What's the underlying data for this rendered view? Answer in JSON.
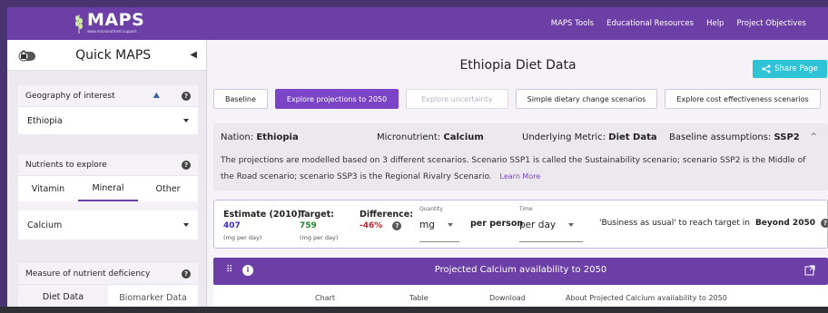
{
  "app": {
    "logo_text": "MAPS",
    "logo_url": "www.micronutrient.support"
  },
  "topnav": [
    "MAPS Tools",
    "Educational Resources",
    "Help",
    "Project Objectives"
  ],
  "sidebar": {
    "title": "Quick MAPS",
    "geography": {
      "label": "Geography of interest",
      "value": "Ethiopia"
    },
    "nutrients": {
      "label": "Nutrients to explore",
      "tabs": [
        "Vitamin",
        "Mineral",
        "Other"
      ],
      "active_tab": "Mineral",
      "value": "Calcium"
    },
    "deficiency": {
      "label": "Measure of nutrient deficiency",
      "tabs": [
        "Diet Data",
        "Biomarker Data"
      ],
      "active_tab": "Diet Data"
    }
  },
  "main": {
    "title": "Ethiopia Diet Data",
    "share_label": "Share Page",
    "tabs": [
      {
        "label": "Baseline",
        "state": "normal"
      },
      {
        "label": "Explore projections to 2050",
        "state": "active"
      },
      {
        "label": "Explore uncertainty",
        "state": "disabled"
      },
      {
        "label": "Simple dietary change scenarios",
        "state": "normal"
      },
      {
        "label": "Explore cost effectiveness scenarios",
        "state": "normal"
      }
    ],
    "info": {
      "nation_label": "Nation:",
      "nation": "Ethiopia",
      "micronutrient_label": "Micronutrient:",
      "micronutrient": "Calcium",
      "metric_label": "Underlying Metric:",
      "metric": "Diet Data",
      "assumptions_label": "Baseline assumptions:",
      "assumptions": "SSP2",
      "description": "The projections are modelled based on 3 different scenarios. Scenario SSP1 is called the Sustainability scenario; scenario SSP2 is the Middle of the Road scenario; scenario SSP3 is the Regional Rivalry Scenario.",
      "learn_more": "Learn More"
    },
    "estimate": {
      "estimate_label": "Estimate (2010):",
      "estimate_value": "407",
      "estimate_unit": "(mg per day)",
      "target_label": "Target:",
      "target_value": "759",
      "target_unit": "(mg per day)",
      "difference_label": "Difference:",
      "difference_value": "-46%",
      "quantity_label": "Quantity",
      "quantity_value": "mg",
      "per_person": "per person",
      "time_label": "Time",
      "time_value": "per day",
      "bau_text": "'Business as usual' to reach target in",
      "bau_value": "Beyond 2050"
    },
    "chart_panel": {
      "title": "Projected Calcium availability to 2050",
      "tabs": [
        "Chart",
        "Table",
        "Download",
        "About Projected Calcium availability to 2050"
      ]
    }
  },
  "colors": {
    "brand_purple": "#6b3fa6",
    "active_tab": "#7b44c6",
    "share_button": "#2ec3d6",
    "estimate_value": "#3b2ec4",
    "target_value": "#1e8a2f",
    "difference_value": "#c0262d"
  }
}
